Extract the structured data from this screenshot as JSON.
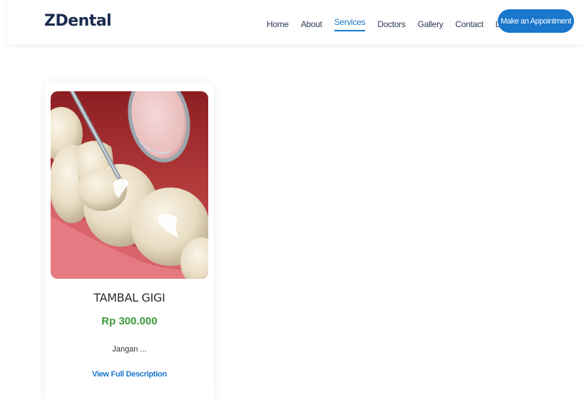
{
  "header": {
    "logo": "ZDental",
    "nav": [
      "Home",
      "About",
      "Services",
      "Doctors",
      "Gallery",
      "Contact",
      "Login"
    ],
    "active_nav": "Services",
    "appointment_button": "Make an Appointment"
  },
  "colors": {
    "brand": "#1977cc",
    "price": "#3a9b3a",
    "logo": "#1a2c4f"
  },
  "service_card": {
    "image_icon": "dental-filling-image",
    "title": "TAMBAL GIGI",
    "price": "Rp 300.000",
    "description": "Jangan ...",
    "link_label": "View Full Description"
  }
}
